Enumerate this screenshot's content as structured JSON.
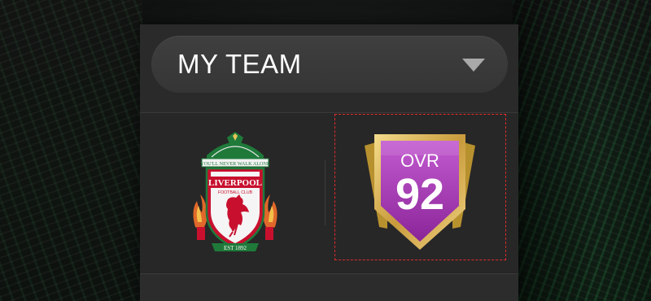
{
  "team_selector": {
    "label": "MY TEAM"
  },
  "club": {
    "motto": "YOU'LL NEVER WALK ALONE",
    "name": "LIVERPOOL",
    "subtitle": "FOOTBALL CLUB",
    "established": "EST 1892"
  },
  "rating": {
    "label": "OVR",
    "value": "92"
  },
  "colors": {
    "accent_purple": "#a838b5",
    "gold": "#d8b65a",
    "liverpool_red": "#c8102e",
    "highlight_border": "#e02b2b"
  },
  "icons": {
    "dropdown": "chevron-down-icon",
    "club": "liverpool-crest-icon",
    "rating": "ovr-badge-icon"
  }
}
